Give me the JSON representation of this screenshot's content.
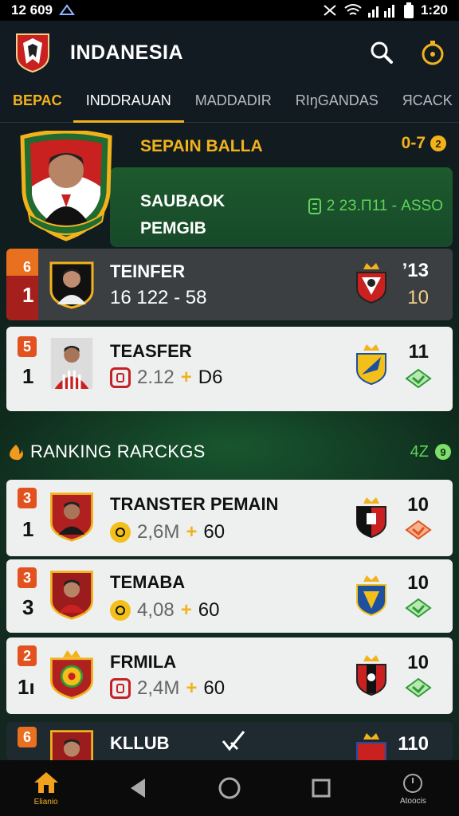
{
  "status_bar": {
    "time_left": "12 609",
    "time_right": "1:20"
  },
  "app": {
    "title": "INDANESIA"
  },
  "tabs": [
    {
      "label": "BEPAC"
    },
    {
      "label": "INDDRAUAN"
    },
    {
      "label": "MADDADIR"
    },
    {
      "label": "RIŋGANDAS"
    },
    {
      "label": "ЯCACK"
    }
  ],
  "featured": {
    "title": "SEPAIN BALLA",
    "score": "0-7",
    "score_badge": "2",
    "name_line1": "SAUBAOK",
    "name_line2": "PEMGIB",
    "stat": "2 2З.П11 - АSSO"
  },
  "top_cards": [
    {
      "badge": "6",
      "rank": "1",
      "name": "TEINFER",
      "stats": "16 122 - 58",
      "right_top": "ʼ13",
      "right_bottom": "10",
      "theme": "dark"
    },
    {
      "badge": "5",
      "rank": "1",
      "name": "TEASFER",
      "stats_value": "2.12",
      "stats_plus": "+",
      "stats_after": "D6",
      "right_top": "11",
      "theme": "light"
    }
  ],
  "section": {
    "title": "RANKING RARCKGS",
    "count": "4Z",
    "count_badge": "9"
  },
  "ranking_cards": [
    {
      "badge": "3",
      "rank": "1",
      "name": "TRANSTER PEMAIN",
      "value": "2,6M",
      "plus": "+",
      "after": "60",
      "right_top": "10",
      "chevron_color": "#e3521e"
    },
    {
      "badge": "3",
      "rank": "3",
      "name": "TEMABA",
      "value": "4,08",
      "plus": "+",
      "after": "60",
      "right_top": "10",
      "chevron_color": "#2e9b3a"
    },
    {
      "badge": "2",
      "rank": "1ı",
      "name": "FRMILA",
      "value": "2,4M",
      "plus": "+",
      "after": "60",
      "right_top": "10",
      "chevron_color": "#2e9b3a"
    },
    {
      "badge": "6",
      "rank": "",
      "name": "KLLUB",
      "right_top": "110"
    }
  ],
  "bottom_nav": {
    "home_label": "Elianio",
    "right_label": "Atoocis"
  },
  "colors": {
    "accent": "#f2b21c",
    "green": "#5fd35a",
    "red": "#c52028"
  }
}
